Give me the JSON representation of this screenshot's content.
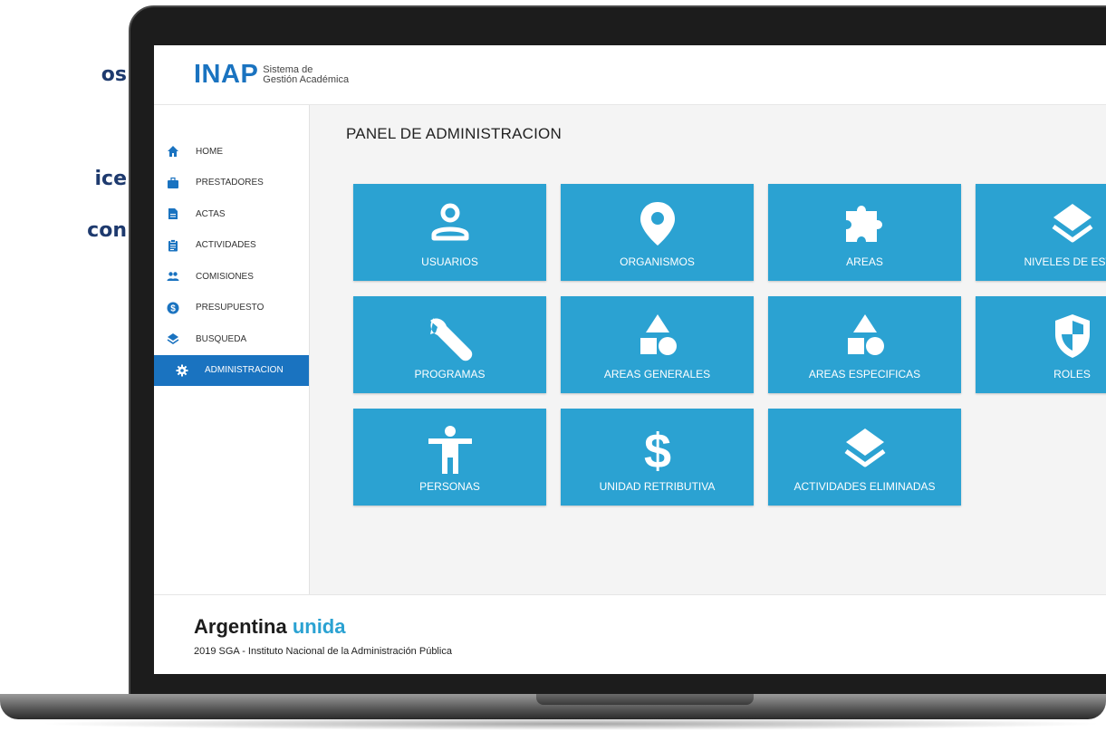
{
  "side_text": [
    "os",
    "ice",
    "con"
  ],
  "header": {
    "logo_word": "INAP",
    "logo_sub_1": "Sistema de",
    "logo_sub_2": "Gestión Académica"
  },
  "sidebar": {
    "items": [
      {
        "label": "HOME",
        "icon": "home-icon"
      },
      {
        "label": "PRESTADORES",
        "icon": "briefcase-icon"
      },
      {
        "label": "ACTAS",
        "icon": "document-icon"
      },
      {
        "label": "ACTIVIDADES",
        "icon": "clipboard-icon"
      },
      {
        "label": "COMISIONES",
        "icon": "people-icon"
      },
      {
        "label": "PRESUPUESTO",
        "icon": "dollar-circle-icon"
      },
      {
        "label": "BUSQUEDA",
        "icon": "layers-icon"
      },
      {
        "label": "ADMINISTRACION",
        "icon": "gear-icon",
        "active": true
      }
    ]
  },
  "main": {
    "title": "PANEL DE ADMINISTRACION",
    "tiles": [
      {
        "label": "USUARIOS",
        "icon": "user-icon"
      },
      {
        "label": "ORGANISMOS",
        "icon": "location-pin-icon"
      },
      {
        "label": "AREAS",
        "icon": "puzzle-icon"
      },
      {
        "label": "NIVELES DE ESTU",
        "icon": "layers-icon"
      },
      {
        "label": "PROGRAMAS",
        "icon": "wrench-icon"
      },
      {
        "label": "AREAS GENERALES",
        "icon": "shapes-icon"
      },
      {
        "label": "AREAS ESPECIFICAS",
        "icon": "shapes-icon"
      },
      {
        "label": "ROLES",
        "icon": "shield-icon"
      },
      {
        "label": "PERSONAS",
        "icon": "person-icon"
      },
      {
        "label": "UNIDAD RETRIBUTIVA",
        "icon": "dollar-icon"
      },
      {
        "label": "ACTIVIDADES ELIMINADAS",
        "icon": "layers-icon"
      }
    ]
  },
  "footer": {
    "brand_1": "Argentina",
    "brand_2": "unida",
    "copyright": "2019 SGA - Instituto Nacional de la Administración Pública"
  },
  "colors": {
    "tile": "#2ba2d2",
    "active_nav": "#1a73c0",
    "logo": "#1a73c0"
  }
}
